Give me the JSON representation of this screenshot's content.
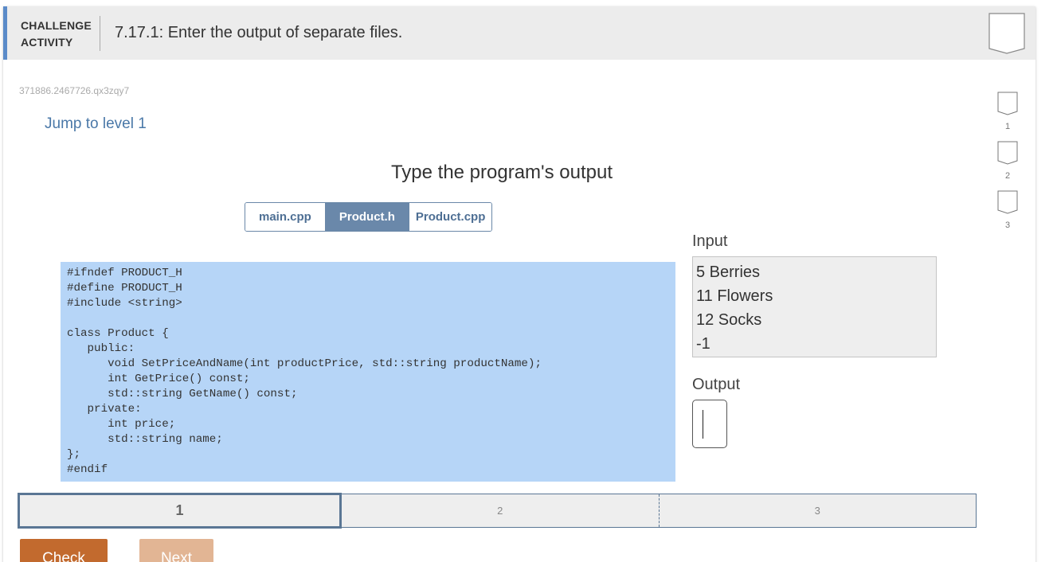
{
  "header": {
    "badge_line1": "CHALLENGE",
    "badge_line2": "ACTIVITY",
    "title": "7.17.1: Enter the output of separate files."
  },
  "activity_id": "371886.2467726.qx3zqy7",
  "jump_link": "Jump to level 1",
  "prompt": "Type the program's output",
  "tabs": [
    {
      "label": "main.cpp",
      "active": false
    },
    {
      "label": "Product.h",
      "active": true
    },
    {
      "label": "Product.cpp",
      "active": false
    }
  ],
  "code_lines": [
    "#ifndef PRODUCT_H",
    "#define PRODUCT_H",
    "#include <string>",
    "",
    "class Product {",
    "   public:",
    "      void SetPriceAndName(int productPrice, std::string productName);",
    "      int GetPrice() const;",
    "      std::string GetName() const;",
    "   private:",
    "      int price;",
    "      std::string name;",
    "};",
    "#endif"
  ],
  "input": {
    "label": "Input",
    "lines": [
      "5 Berries",
      "11 Flowers",
      "12 Socks",
      "-1"
    ]
  },
  "output": {
    "label": "Output",
    "value": ""
  },
  "progress": {
    "segments": [
      "1",
      "2",
      "3"
    ],
    "current": 1
  },
  "buttons": {
    "check": "Check",
    "next": "Next"
  },
  "level_nav": [
    "1",
    "2",
    "3"
  ],
  "colors": {
    "accent": "#5b8bc9",
    "tab_active": "#6a88aa",
    "code_bg": "#b6d5f7",
    "check_btn": "#c26a2e",
    "next_btn": "#e2b594"
  }
}
